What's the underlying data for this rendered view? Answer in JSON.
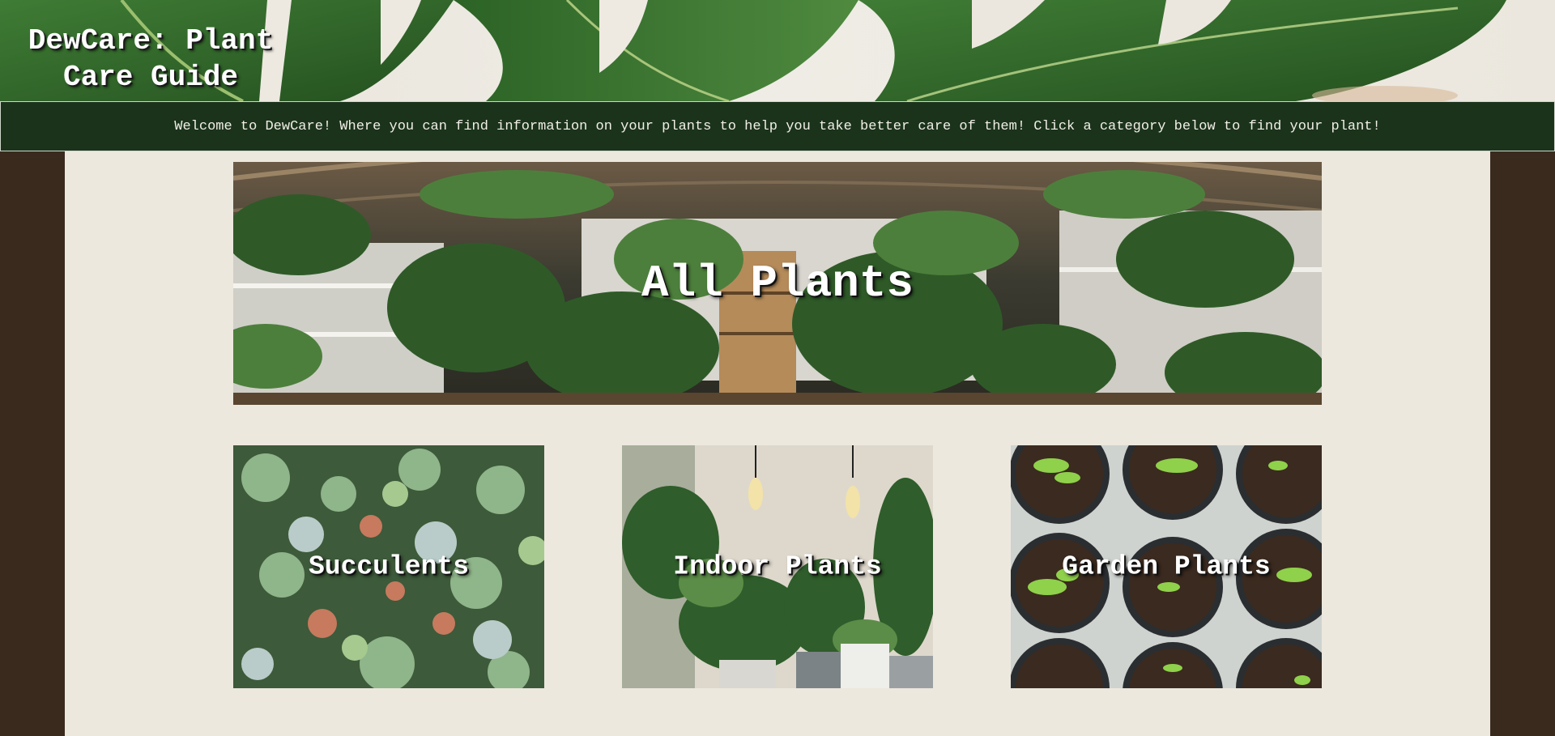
{
  "header": {
    "title": "DewCare: Plant Care Guide"
  },
  "welcome": {
    "text": "Welcome to DewCare! Where you can find information on your plants to help you take better care of them! Click a category below to find your plant!"
  },
  "categories": {
    "all": {
      "label": "All Plants"
    },
    "items": [
      {
        "label": "Succulents"
      },
      {
        "label": "Indoor Plants"
      },
      {
        "label": "Garden Plants"
      }
    ]
  },
  "colors": {
    "page_background": "#3a2a1e",
    "content_background": "#ece8de",
    "welcome_bar": "#1b331b",
    "leaf_green": "#2f6b2a",
    "text_light": "#ffffff"
  }
}
